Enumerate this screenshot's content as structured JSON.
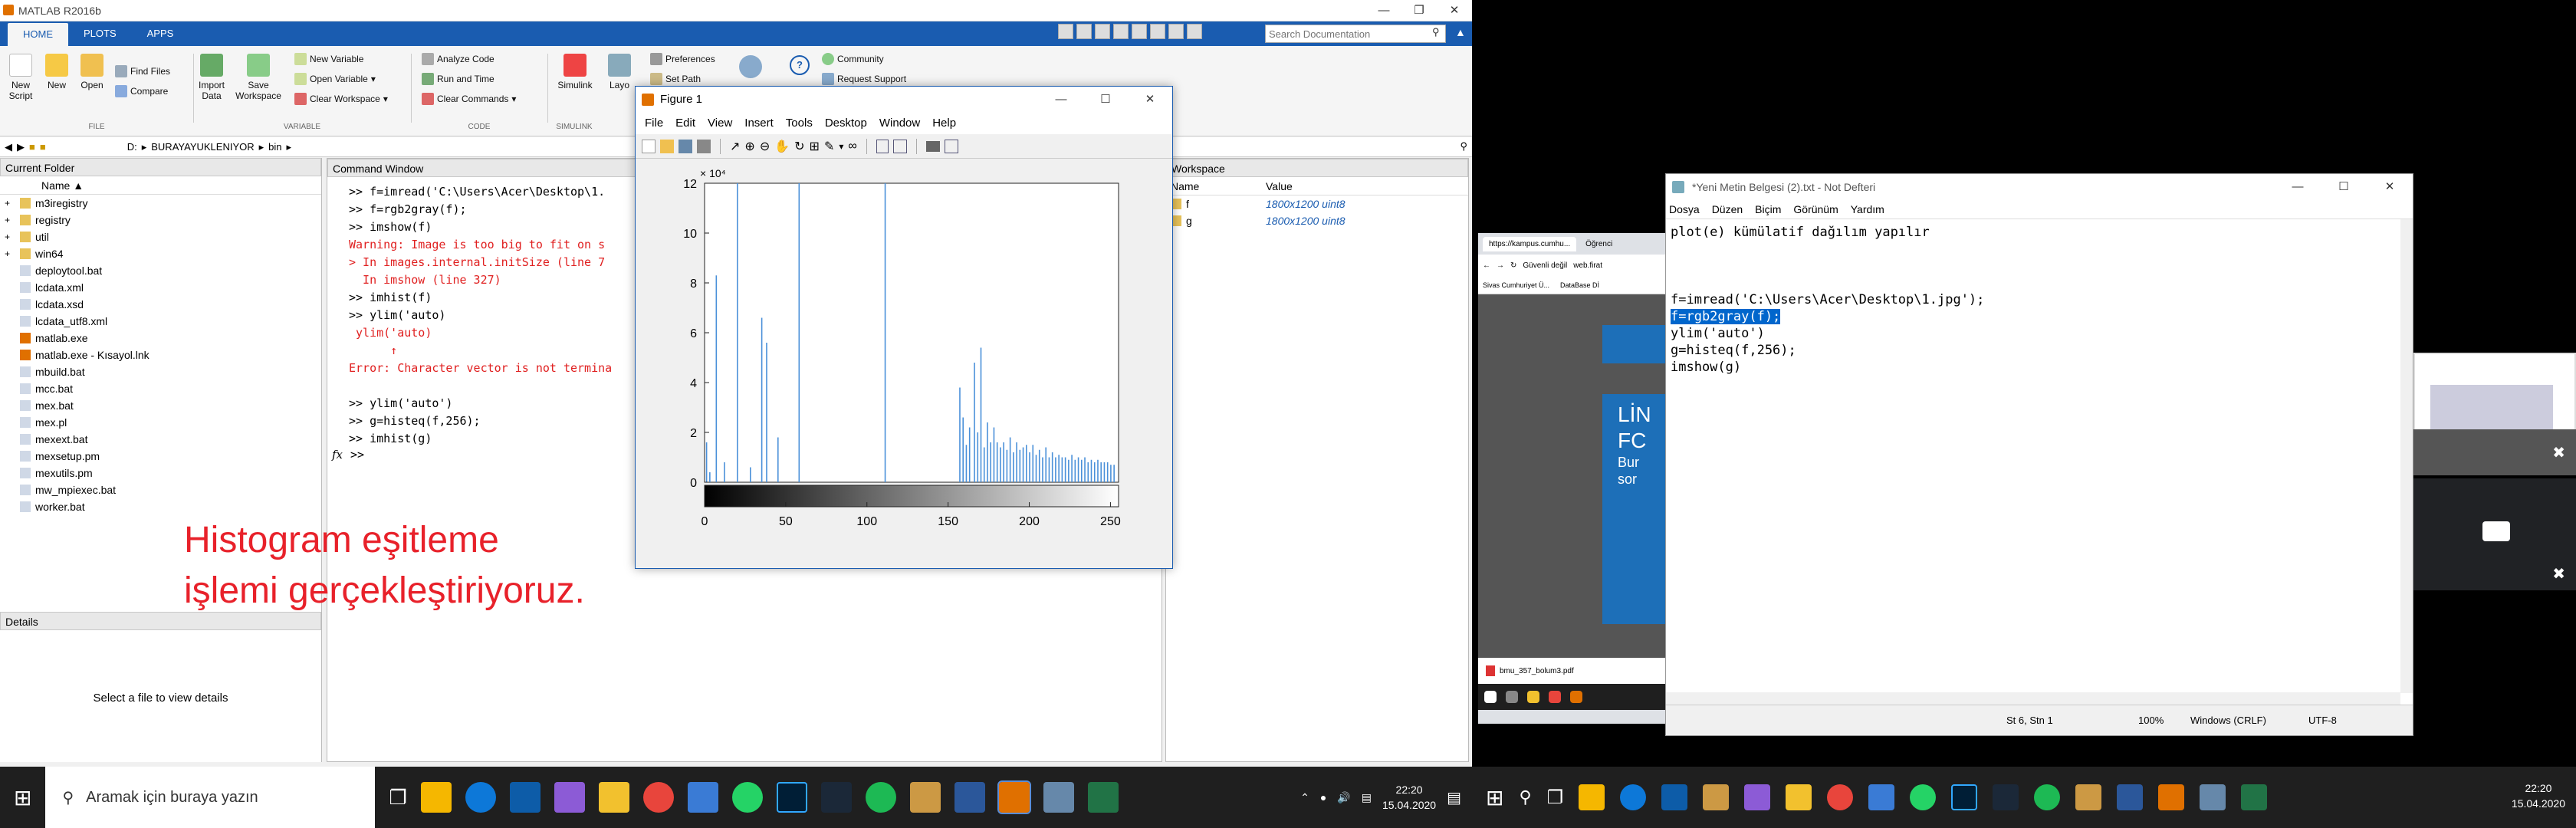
{
  "matlab": {
    "title": "MATLAB R2016b",
    "tabs": [
      "HOME",
      "PLOTS",
      "APPS"
    ],
    "search_placeholder": "Search Documentation",
    "ribbon": {
      "new_script": "New Script",
      "new": "New",
      "open": "Open",
      "find_files": "Find Files",
      "compare": "Compare",
      "import_data": "Import Data",
      "save_workspace": "Save Workspace",
      "new_variable": "New Variable",
      "open_variable": "Open Variable",
      "clear_workspace": "Clear Workspace",
      "analyze_code": "Analyze Code",
      "run_and_time": "Run and Time",
      "clear_commands": "Clear Commands",
      "simulink": "Simulink",
      "layout": "Layo",
      "preferences": "Preferences",
      "set_path": "Set Path",
      "community": "Community",
      "request_support": "Request Support",
      "group_file": "FILE",
      "group_variable": "VARIABLE",
      "group_code": "CODE",
      "group_simulink": "SIMULINK"
    },
    "path": [
      "D:",
      "BURAYAYUKLENIYOR",
      "bin"
    ],
    "current_folder": {
      "title": "Current Folder",
      "name_col": "Name",
      "items": [
        {
          "name": "m3iregistry",
          "type": "folder"
        },
        {
          "name": "registry",
          "type": "folder"
        },
        {
          "name": "util",
          "type": "folder"
        },
        {
          "name": "win64",
          "type": "folder"
        },
        {
          "name": "deploytool.bat",
          "type": "file"
        },
        {
          "name": "lcdata.xml",
          "type": "file"
        },
        {
          "name": "lcdata.xsd",
          "type": "file"
        },
        {
          "name": "lcdata_utf8.xml",
          "type": "file"
        },
        {
          "name": "matlab.exe",
          "type": "exe"
        },
        {
          "name": "matlab.exe - Kısayol.lnk",
          "type": "exe"
        },
        {
          "name": "mbuild.bat",
          "type": "file"
        },
        {
          "name": "mcc.bat",
          "type": "file"
        },
        {
          "name": "mex.bat",
          "type": "file"
        },
        {
          "name": "mex.pl",
          "type": "file"
        },
        {
          "name": "mexext.bat",
          "type": "file"
        },
        {
          "name": "mexsetup.pm",
          "type": "file"
        },
        {
          "name": "mexutils.pm",
          "type": "file"
        },
        {
          "name": "mw_mpiexec.bat",
          "type": "file"
        },
        {
          "name": "worker.bat",
          "type": "file"
        }
      ]
    },
    "details": {
      "title": "Details",
      "empty": "Select a file to view details"
    },
    "command_window": {
      "title": "Command Window",
      "lines": [
        {
          "text": ">> f=imread('C:\\Users\\Acer\\Desktop\\1.",
          "cls": ""
        },
        {
          "text": ">> f=rgb2gray(f);",
          "cls": ""
        },
        {
          "text": ">> imshow(f)",
          "cls": ""
        },
        {
          "text": "Warning: Image is too big to fit on s",
          "cls": "red"
        },
        {
          "text": "> In images.internal.initSize (line 7",
          "cls": "red"
        },
        {
          "text": "  In imshow (line 327)",
          "cls": "red"
        },
        {
          "text": ">> imhist(f)",
          "cls": ""
        },
        {
          "text": ">> ylim('auto)",
          "cls": ""
        },
        {
          "text": " ylim('auto)",
          "cls": "red"
        },
        {
          "text": "      ↑",
          "cls": "red"
        },
        {
          "text": "Error: Character vector is not termina",
          "cls": "red"
        },
        {
          "text": " ",
          "cls": ""
        },
        {
          "text": ">> ylim('auto')",
          "cls": ""
        },
        {
          "text": ">> g=histeq(f,256);",
          "cls": ""
        },
        {
          "text": ">> imhist(g)",
          "cls": ""
        }
      ],
      "prompt": ">>",
      "fx": "fx"
    },
    "workspace": {
      "title": "Workspace",
      "col_name": "Name",
      "col_value": "Value",
      "vars": [
        {
          "name": "f",
          "value": "1800x1200 uint8"
        },
        {
          "name": "g",
          "value": "1800x1200 uint8"
        }
      ]
    },
    "overlay": {
      "line1": "Histogram eşitleme",
      "line2": "işlemi gerçekleştiriyoruz."
    }
  },
  "figure": {
    "title": "Figure 1",
    "menu": [
      "File",
      "Edit",
      "View",
      "Insert",
      "Tools",
      "Desktop",
      "Window",
      "Help"
    ],
    "exponent": "× 10⁴"
  },
  "chart_data": {
    "type": "bar",
    "title": "",
    "xlabel": "",
    "ylabel": "",
    "xlim": [
      0,
      255
    ],
    "ylim": [
      0,
      12
    ],
    "x_ticks": [
      "0",
      "50",
      "100",
      "150",
      "200",
      "250"
    ],
    "y_ticks": [
      "0",
      "2",
      "4",
      "6",
      "8",
      "10",
      "12"
    ],
    "y_scale_label": "× 10^4",
    "x": [
      1,
      3,
      7,
      12,
      20,
      28,
      35,
      38,
      45,
      58,
      111,
      157,
      159,
      161,
      163,
      166,
      168,
      170,
      172,
      174,
      176,
      178,
      180,
      182,
      184,
      186,
      188,
      190,
      192,
      194,
      196,
      198,
      200,
      202,
      204,
      206,
      208,
      210,
      212,
      214,
      216,
      218,
      220,
      222,
      224,
      226,
      228,
      230,
      232,
      234,
      236,
      238,
      240,
      242,
      244,
      246,
      248,
      250,
      252
    ],
    "values": [
      1.6,
      0.4,
      8.3,
      0.8,
      12.0,
      0.6,
      6.6,
      5.6,
      1.8,
      12.0,
      12.0,
      3.8,
      2.6,
      1.5,
      2.2,
      4.8,
      2.0,
      5.4,
      1.4,
      2.4,
      1.6,
      2.2,
      1.6,
      1.4,
      1.6,
      1.3,
      1.8,
      1.2,
      1.6,
      1.3,
      1.4,
      1.5,
      1.2,
      1.5,
      1.1,
      1.3,
      1.0,
      1.4,
      1.0,
      1.2,
      1.0,
      1.1,
      1.0,
      1.0,
      0.9,
      1.1,
      0.9,
      1.0,
      0.9,
      1.0,
      0.8,
      0.9,
      0.8,
      0.9,
      0.8,
      0.8,
      0.8,
      0.7,
      0.7
    ]
  },
  "taskbar_left": {
    "search_placeholder": "Aramak için buraya yazın",
    "time": "22:20",
    "date": "15.04.2020"
  },
  "browser": {
    "tabs": [
      "https://kampus.cumhu...",
      "Öğrenci",
      "Öğre"
    ],
    "url_security": "Güvenli değil",
    "url": "web.firat",
    "bookmarks": [
      "Sivas Cumhuriyet Ü...",
      "DataBase Dİ"
    ],
    "download": "bmu_357_bolum3.pdf",
    "banner": [
      "LİN",
      "FC",
      "Bur",
      "sor"
    ]
  },
  "notepad": {
    "title": "*Yeni Metin Belgesi (2).txt - Not Defteri",
    "menu": [
      "Dosya",
      "Düzen",
      "Biçim",
      "Görünüm",
      "Yardım"
    ],
    "lines": [
      "plot(e) kümülatif dağılım yapılır",
      "",
      "",
      "",
      "f=imread('C:\\Users\\Acer\\Desktop\\1.jpg');",
      "f=rgb2gray(f);",
      "ylim('auto')",
      "g=histeq(f,256);",
      "imshow(g)"
    ],
    "status": {
      "pos": "St 6, Stn 1",
      "zoom": "100%",
      "eol": "Windows (CRLF)",
      "enc": "UTF-8"
    }
  },
  "taskbar_right": {
    "time": "22:20",
    "date": "15.04.2020"
  }
}
